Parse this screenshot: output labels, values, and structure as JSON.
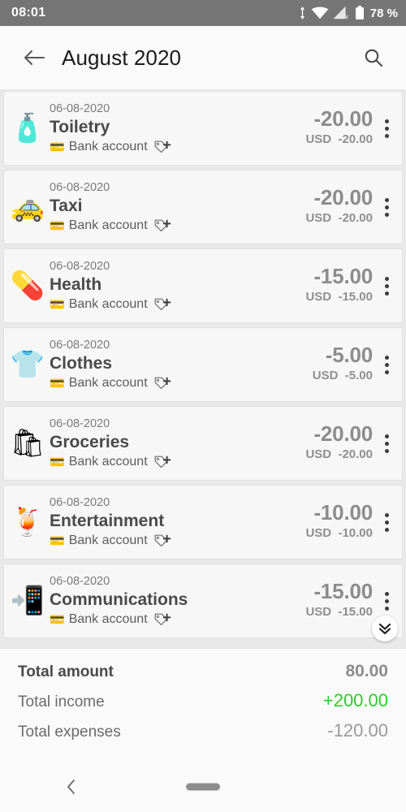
{
  "statusbar": {
    "time": "08:01",
    "battery_text": "78 %",
    "icons": [
      "data-transfer-icon",
      "wifi-icon",
      "cellular-signal-off-icon",
      "battery-icon"
    ],
    "background_color": "#757575"
  },
  "appbar": {
    "back_icon": "arrow-left-icon",
    "title": "August 2020",
    "search_icon": "search-icon"
  },
  "list": {
    "account_emoji": "credit-card-icon",
    "tag_icon": "tag-add-icon",
    "menu_icon": "kebab-menu-icon",
    "scroll_fab_icon": "double-chevron-down-icon",
    "transactions": [
      {
        "emoji": "🧴",
        "emoji_name": "toiletry-icon",
        "date": "06-08-2020",
        "category": "Toiletry",
        "account": "Bank account",
        "amount": "-20.00",
        "currency": "USD",
        "converted": "-20.00"
      },
      {
        "emoji": "🚕",
        "emoji_name": "taxi-icon",
        "date": "06-08-2020",
        "category": "Taxi",
        "account": "Bank account",
        "amount": "-20.00",
        "currency": "USD",
        "converted": "-20.00"
      },
      {
        "emoji": "💊",
        "emoji_name": "health-icon",
        "date": "06-08-2020",
        "category": "Health",
        "account": "Bank account",
        "amount": "-15.00",
        "currency": "USD",
        "converted": "-15.00"
      },
      {
        "emoji": "👕",
        "emoji_name": "clothes-icon",
        "date": "06-08-2020",
        "category": "Clothes",
        "account": "Bank account",
        "amount": "-5.00",
        "currency": "USD",
        "converted": "-5.00"
      },
      {
        "emoji": "🛍",
        "emoji_name": "groceries-icon",
        "date": "06-08-2020",
        "category": "Groceries",
        "account": "Bank account",
        "amount": "-20.00",
        "currency": "USD",
        "converted": "-20.00"
      },
      {
        "emoji": "🍹",
        "emoji_name": "entertainment-icon",
        "date": "06-08-2020",
        "category": "Entertainment",
        "account": "Bank account",
        "amount": "-10.00",
        "currency": "USD",
        "converted": "-10.00"
      },
      {
        "emoji": "📲",
        "emoji_name": "communications-icon",
        "date": "06-08-2020",
        "category": "Communications",
        "account": "Bank account",
        "amount": "-15.00",
        "currency": "USD",
        "converted": "-15.00"
      }
    ]
  },
  "summary": {
    "total_amount_label": "Total amount",
    "total_amount_value": "80.00",
    "total_income_label": "Total income",
    "total_income_value": "+200.00",
    "total_expenses_label": "Total expenses",
    "total_expenses_value": "-120.00",
    "income_color": "#2ecc2e"
  },
  "navbar": {
    "back_icon": "chevron-left-icon",
    "home_pill": "home-indicator-pill"
  }
}
